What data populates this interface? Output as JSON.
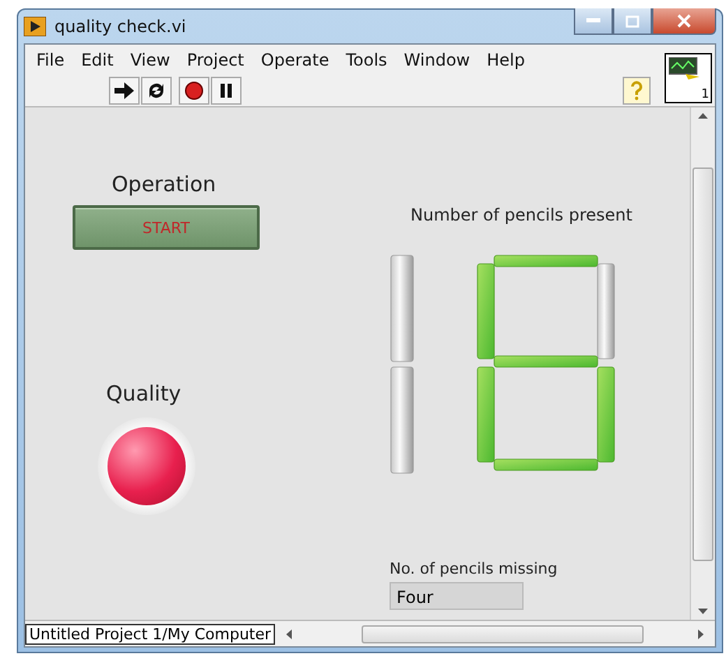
{
  "window": {
    "title": "quality check.vi"
  },
  "menu": [
    "File",
    "Edit",
    "View",
    "Project",
    "Operate",
    "Tools",
    "Window",
    "Help"
  ],
  "connector_pane": {
    "label": "1"
  },
  "panel": {
    "operation": {
      "label": "Operation",
      "button": "START"
    },
    "quality": {
      "label": "Quality",
      "on": true
    },
    "display": {
      "label": "Number of pencils present",
      "digits": [
        {
          "segments": [
            {
              "kind": "b",
              "on": false
            },
            {
              "kind": "c",
              "on": false
            }
          ]
        },
        {
          "segments": [
            {
              "kind": "a",
              "on": true
            },
            {
              "kind": "b",
              "on": false
            },
            {
              "kind": "c",
              "on": true
            },
            {
              "kind": "d",
              "on": true
            },
            {
              "kind": "e",
              "on": true
            },
            {
              "kind": "f",
              "on": true
            },
            {
              "kind": "g",
              "on": true
            }
          ]
        }
      ]
    },
    "missing": {
      "label": "No. of pencils missing",
      "value": "Four"
    }
  },
  "status_bar": {
    "project": "Untitled Project 1/My Computer"
  }
}
